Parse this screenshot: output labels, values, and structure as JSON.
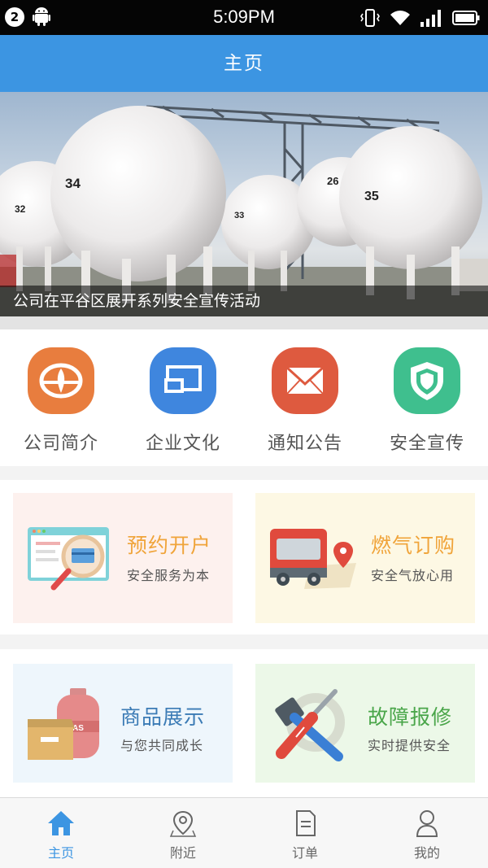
{
  "status_bar": {
    "notification_count": "2",
    "time": "5:09PM",
    "icons": [
      "android-icon",
      "vibrate-icon",
      "wifi-icon",
      "signal-icon",
      "battery-icon"
    ]
  },
  "header": {
    "title": "主页"
  },
  "banner": {
    "caption": "公司在平谷区展开系列安全宣传活动",
    "tank_numbers": [
      "32",
      "34",
      "33",
      "26",
      "35"
    ]
  },
  "quick_menu": [
    {
      "label": "公司简介",
      "icon": "company-logo-icon",
      "color": "#e87d3e"
    },
    {
      "label": "企业文化",
      "icon": "culture-screen-icon",
      "color": "#3f86de"
    },
    {
      "label": "通知公告",
      "icon": "envelope-icon",
      "color": "#de5a3f"
    },
    {
      "label": "安全宣传",
      "icon": "shield-icon",
      "color": "#3fbf8e"
    }
  ],
  "cards": [
    {
      "title": "预约开户",
      "subtitle": "安全服务为本",
      "icon": "magnifier-card-icon",
      "bg": "#fdf1ee",
      "title_color": "#f0a43a"
    },
    {
      "title": "燃气订购",
      "subtitle": "安全气放心用",
      "icon": "delivery-truck-icon",
      "bg": "#fdf8e4",
      "title_color": "#f0a43a"
    },
    {
      "title": "商品展示",
      "subtitle": "与您共同成长",
      "icon": "gas-cylinder-box-icon",
      "bg": "#eef6fc",
      "title_color": "#3b7bb5"
    },
    {
      "title": "故障报修",
      "subtitle": "实时提供安全",
      "icon": "repair-tools-icon",
      "bg": "#ecf8e8",
      "title_color": "#4aa64a"
    }
  ],
  "bottom_nav": [
    {
      "label": "主页",
      "icon": "home-icon",
      "active": true
    },
    {
      "label": "附近",
      "icon": "location-pin-icon",
      "active": false
    },
    {
      "label": "订单",
      "icon": "document-icon",
      "active": false
    },
    {
      "label": "我的",
      "icon": "user-icon",
      "active": false
    }
  ],
  "colors": {
    "primary": "#3c95e2",
    "status_bar": "#050505"
  }
}
